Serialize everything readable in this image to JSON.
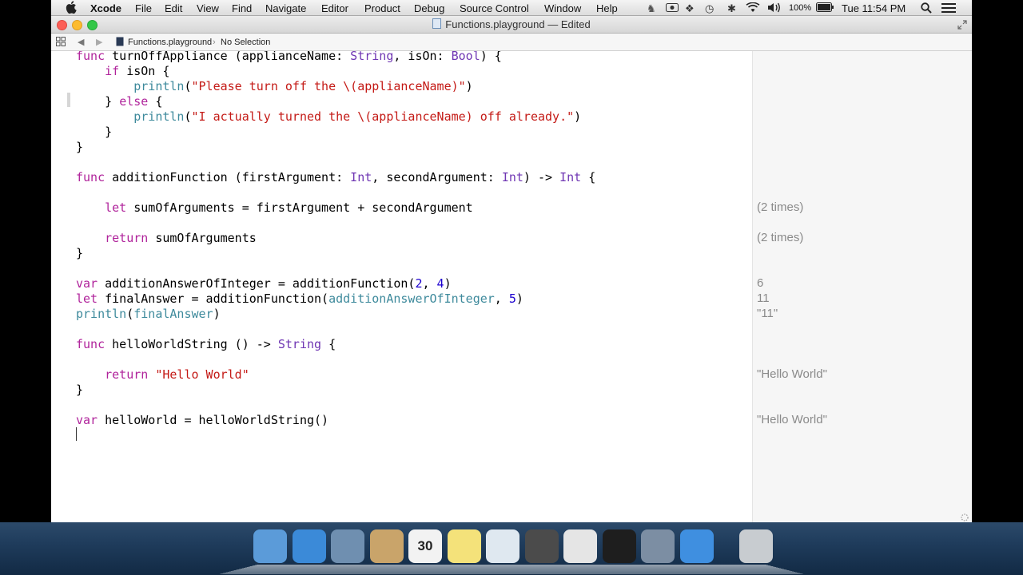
{
  "menubar": {
    "app_name": "Xcode",
    "items": [
      "File",
      "Edit",
      "View",
      "Find",
      "Navigate",
      "Editor",
      "Product",
      "Debug",
      "Source Control",
      "Window",
      "Help"
    ],
    "battery": "100%",
    "clock": "Tue 11:54 PM"
  },
  "window": {
    "title": "Functions.playground — Edited"
  },
  "jumpbar": {
    "file": "Functions.playground",
    "selection": "No Selection"
  },
  "code": [
    [
      {
        "t": "func",
        "c": "kw"
      },
      {
        "t": " turnOffAppliance (applianceName: "
      },
      {
        "t": "String",
        "c": "ty"
      },
      {
        "t": ", isOn: "
      },
      {
        "t": "Bool",
        "c": "ty"
      },
      {
        "t": ") {"
      }
    ],
    [
      {
        "t": "    "
      },
      {
        "t": "if",
        "c": "kw"
      },
      {
        "t": " isOn {"
      }
    ],
    [
      {
        "t": "        "
      },
      {
        "t": "println",
        "c": "vr"
      },
      {
        "t": "("
      },
      {
        "t": "\"Please turn off the \\(applianceName)\"",
        "c": "st"
      },
      {
        "t": ")"
      }
    ],
    [
      {
        "t": "    } "
      },
      {
        "t": "else",
        "c": "kw"
      },
      {
        "t": " {"
      }
    ],
    [
      {
        "t": "        "
      },
      {
        "t": "println",
        "c": "vr"
      },
      {
        "t": "("
      },
      {
        "t": "\"I actually turned the \\(applianceName) off already.\"",
        "c": "st"
      },
      {
        "t": ")"
      }
    ],
    [
      {
        "t": "    }"
      }
    ],
    [
      {
        "t": "}"
      }
    ],
    [
      {
        "t": ""
      }
    ],
    [
      {
        "t": "func",
        "c": "kw"
      },
      {
        "t": " additionFunction (firstArgument: "
      },
      {
        "t": "Int",
        "c": "ty"
      },
      {
        "t": ", secondArgument: "
      },
      {
        "t": "Int",
        "c": "ty"
      },
      {
        "t": ") -> "
      },
      {
        "t": "Int",
        "c": "ty"
      },
      {
        "t": " {"
      }
    ],
    [
      {
        "t": ""
      }
    ],
    [
      {
        "t": "    "
      },
      {
        "t": "let",
        "c": "kw"
      },
      {
        "t": " sumOfArguments = firstArgument + secondArgument"
      }
    ],
    [
      {
        "t": ""
      }
    ],
    [
      {
        "t": "    "
      },
      {
        "t": "return",
        "c": "kw"
      },
      {
        "t": " sumOfArguments"
      }
    ],
    [
      {
        "t": "}"
      }
    ],
    [
      {
        "t": ""
      }
    ],
    [
      {
        "t": "var",
        "c": "kw"
      },
      {
        "t": " additionAnswerOfInteger = additionFunction("
      },
      {
        "t": "2",
        "c": "nm"
      },
      {
        "t": ", "
      },
      {
        "t": "4",
        "c": "nm"
      },
      {
        "t": ")"
      }
    ],
    [
      {
        "t": "let",
        "c": "kw"
      },
      {
        "t": " finalAnswer = additionFunction("
      },
      {
        "t": "additionAnswerOfInteger",
        "c": "vr"
      },
      {
        "t": ", "
      },
      {
        "t": "5",
        "c": "nm"
      },
      {
        "t": ")"
      }
    ],
    [
      {
        "t": "println",
        "c": "vr"
      },
      {
        "t": "("
      },
      {
        "t": "finalAnswer",
        "c": "vr"
      },
      {
        "t": ")"
      }
    ],
    [
      {
        "t": ""
      }
    ],
    [
      {
        "t": "func",
        "c": "kw"
      },
      {
        "t": " helloWorldString () -> "
      },
      {
        "t": "String",
        "c": "ty"
      },
      {
        "t": " {"
      }
    ],
    [
      {
        "t": ""
      }
    ],
    [
      {
        "t": "    "
      },
      {
        "t": "return",
        "c": "kw"
      },
      {
        "t": " "
      },
      {
        "t": "\"Hello World\"",
        "c": "st"
      }
    ],
    [
      {
        "t": "}"
      }
    ],
    [
      {
        "t": ""
      }
    ],
    [
      {
        "t": "var",
        "c": "kw"
      },
      {
        "t": " helloWorld = helloWorldString()"
      }
    ]
  ],
  "results": [
    {
      "line": 10,
      "text": "(2 times)"
    },
    {
      "line": 12,
      "text": "(2 times)"
    },
    {
      "line": 15,
      "text": "6"
    },
    {
      "line": 16,
      "text": "11"
    },
    {
      "line": 17,
      "text": "\"11\""
    },
    {
      "line": 21,
      "text": "\"Hello World\""
    },
    {
      "line": 24,
      "text": "\"Hello World\""
    }
  ],
  "dock": {
    "items": [
      {
        "name": "finder-icon",
        "color": "#5b9bd9"
      },
      {
        "name": "safari-icon",
        "color": "#3b8ad8"
      },
      {
        "name": "mail-icon",
        "color": "#6f8fb0"
      },
      {
        "name": "contacts-icon",
        "color": "#c9a46a"
      },
      {
        "name": "calendar-icon",
        "color": "#f2f2f2",
        "label": "30"
      },
      {
        "name": "notes-icon",
        "color": "#f4e27a"
      },
      {
        "name": "preview-icon",
        "color": "#dfe8f0"
      },
      {
        "name": "sublime-text-icon",
        "color": "#4b4b4b"
      },
      {
        "name": "chrome-icon",
        "color": "#e5e5e5"
      },
      {
        "name": "terminal-icon",
        "color": "#1e1e1e"
      },
      {
        "name": "imovie-icon",
        "color": "#7c8ea3"
      },
      {
        "name": "xcode-icon",
        "color": "#3f8fe0"
      },
      {
        "name": "trash-icon",
        "color": "#c8ccd0"
      }
    ]
  },
  "colors": {
    "keyword": "#b0239b",
    "type": "#6f36b3",
    "string": "#c41a16",
    "number": "#1c00cf",
    "variable": "#3e8a9c",
    "result_text": "#8a8a8a"
  }
}
